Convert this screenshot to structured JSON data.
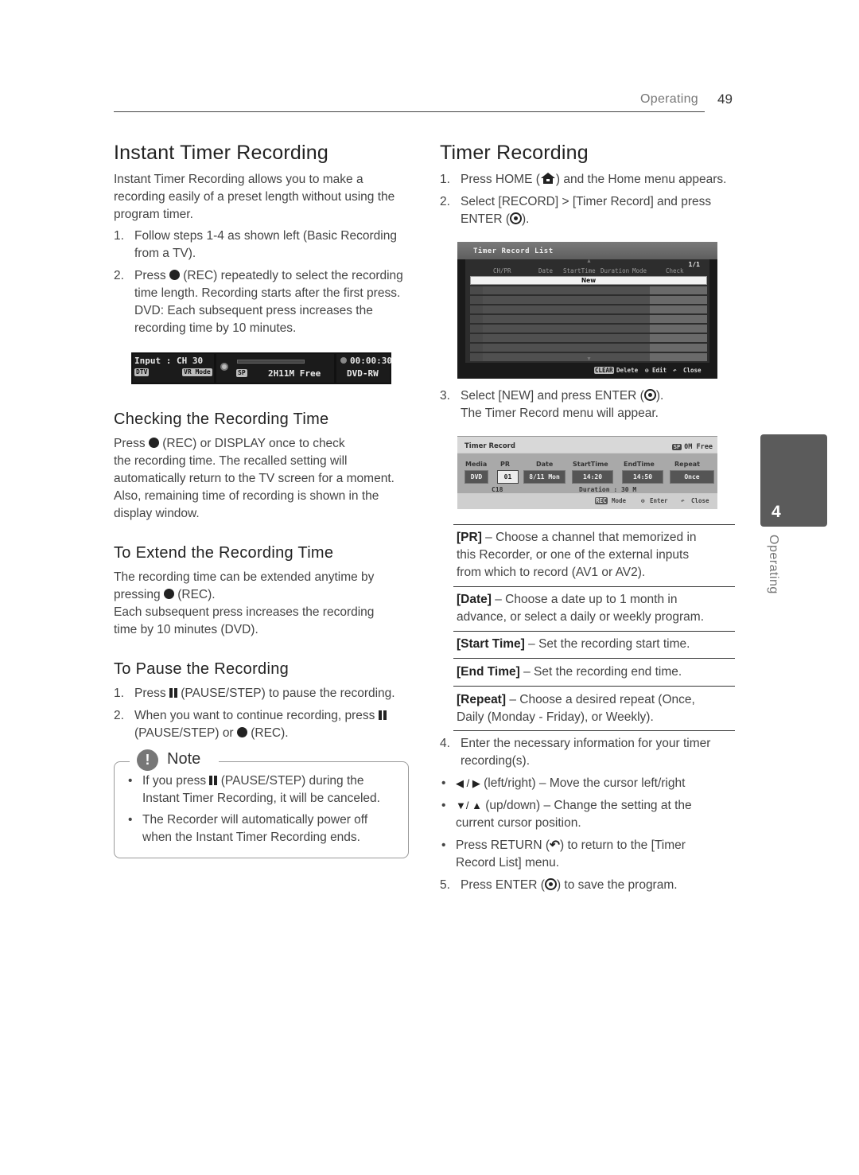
{
  "header": {
    "section": "Operating",
    "page_number": "49"
  },
  "side_tab": {
    "chapter": "4",
    "label": "Operating"
  },
  "left": {
    "title": "Instant Timer Recording",
    "intro": "Instant Timer Recording allows you to make a recording easily of a preset length without using the program timer.",
    "steps": [
      {
        "num": "1.",
        "lines": [
          "Follow steps 1-4 as shown left (Basic Recording",
          "from a TV)."
        ]
      },
      {
        "num": "2.",
        "pre": "Press ",
        "post": " (REC) repeatedly to select the recording",
        "lines": [
          "time length. Recording starts after the first press.",
          "DVD: Each subsequent press increases the",
          "recording time by 10 minutes."
        ]
      }
    ],
    "osd": {
      "input": "Input : CH 30",
      "dtv": "DTV",
      "vr_mode": "VR Mode",
      "sp": "SP",
      "free": "2H11M Free",
      "time": "00:00:30",
      "disc": "DVD-RW"
    },
    "checking": {
      "title": "Checking the Recording Time",
      "line1_pre": "Press ",
      "line1_post": " (REC) or DISPLAY once to check",
      "lines": [
        "the recording time. The recalled setting will",
        "automatically return to the TV screen for a moment.",
        "Also, remaining time of recording is shown in the",
        "display window."
      ]
    },
    "extend": {
      "title": "To Extend the Recording Time",
      "line1": "The recording time can be extended anytime by",
      "line2_pre": "pressing ",
      "line2_post": " (REC).",
      "lines": [
        "Each subsequent press increases the recording",
        "time by 10 minutes (DVD)."
      ]
    },
    "pause": {
      "title": "To Pause the Recording",
      "step1_num": "1.",
      "step1_pre": "Press ",
      "step1_post": " (PAUSE/STEP) to pause the recording.",
      "step2_num": "2.",
      "step2_line1": "When you want to continue recording, press ",
      "step2_line2_pre": "(PAUSE/STEP) or ",
      "step2_line2_post": " (REC)."
    },
    "note": {
      "icon": "!",
      "title": "Note",
      "items": [
        {
          "pre": "If you press ",
          "post": " (PAUSE/STEP) during the",
          "line2": "Instant Timer Recording, it will be canceled."
        },
        {
          "line1": "The Recorder will automatically power off",
          "line2": "when the Instant Timer Recording ends."
        }
      ]
    }
  },
  "right": {
    "title": "Timer Recording",
    "step1": {
      "num": "1.",
      "pre": "Press HOME (",
      "post": ") and the Home menu appears."
    },
    "step2": {
      "num": "2.",
      "line1": "Select [RECORD] > [Timer Record] and press",
      "line2_pre": "ENTER (",
      "line2_post": ")."
    },
    "timer_list": {
      "title": "Timer Record List",
      "page": "1/1",
      "columns": [
        "CH/PR",
        "Date",
        "StartTime",
        "Duration",
        "Mode",
        "Check"
      ],
      "new_row": "New",
      "footer": {
        "clear": "CLEAR",
        "delete": "Delete",
        "edit": "Edit",
        "close": "Close"
      }
    },
    "step3": {
      "num": "3.",
      "pre": "Select [NEW] and press ENTER (",
      "post": ").",
      "line2": "The Timer Record menu will appear."
    },
    "timer_record": {
      "title": "Timer Record",
      "sp": "SP",
      "free": "0M  Free",
      "labels": [
        "Media",
        "PR",
        "Date",
        "StartTime",
        "EndTime",
        "Repeat"
      ],
      "values": [
        "DVD",
        "01",
        "8/11 Mon",
        "14:20",
        "14:50",
        "Once"
      ],
      "channel": "C18",
      "duration": "Duration  :  30  M",
      "footer": {
        "rec": "REC",
        "mode": "Mode",
        "enter": "Enter",
        "close": "Close"
      }
    },
    "definitions": [
      {
        "term": "[PR]",
        "lines": [
          " – Choose a channel that memorized in",
          "this Recorder, or one of the external inputs",
          "from which to record (AV1 or AV2)."
        ]
      },
      {
        "term": "[Date]",
        "lines": [
          " – Choose a date up to 1 month in",
          "advance, or select a daily or weekly program."
        ]
      },
      {
        "term": "[Start Time]",
        "lines": [
          " – Set the recording start time."
        ]
      },
      {
        "term": "[End Time]",
        "lines": [
          " – Set the recording end time."
        ]
      },
      {
        "term": "[Repeat]",
        "lines": [
          " – Choose a desired repeat (Once,",
          "Daily (Monday - Friday), or Weekly)."
        ]
      }
    ],
    "step4": {
      "num": "4.",
      "line1": "Enter the necessary information for your timer",
      "line2": "recording(s)."
    },
    "bullets": [
      {
        "glyph": "◀ / ▶",
        "text": " (left/right) – Move the cursor left/right"
      },
      {
        "glyph": "▼/ ▲",
        "text": " (up/down) – Change the setting at the",
        "line2": "current cursor position."
      },
      {
        "pre": "Press RETURN (",
        "glyph": "↶",
        "post": ") to return to the [Timer",
        "line2": "Record List] menu."
      }
    ],
    "step5": {
      "num": "5.",
      "pre": "Press ENTER (",
      "post": ") to save the program."
    }
  }
}
